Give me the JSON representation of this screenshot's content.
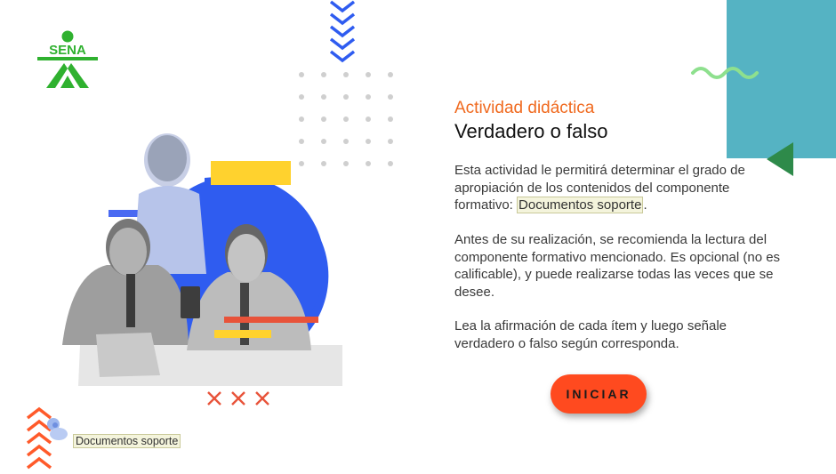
{
  "logo": {
    "text": "SENA",
    "color": "#2fb12f"
  },
  "content": {
    "subtitle": "Actividad didáctica",
    "title": "Verdadero o falso",
    "p1_before": "Esta actividad le permitirá determinar el grado de apropiación de los contenidos del componente formativo: ",
    "p1_link": "Documentos soporte",
    "p1_after": ".",
    "p2": "Antes de su realización, se recomienda la lectura del componente formativo mencionado. Es opcional (no es calificable), y puede realizarse todas las veces que se desee.",
    "p3": "Lea la afirmación de cada ítem y luego señale verdadero o falso según corresponda."
  },
  "start_button": {
    "label": "INICIAR"
  },
  "footer_link": {
    "label": "Documentos soporte"
  },
  "colors": {
    "accent_orange": "#f06a1f",
    "button": "#ff4a1f",
    "teal": "#55b3c3",
    "green": "#2e8a4a",
    "blue": "#2f5cf0",
    "yellow": "#ffd22e",
    "red": "#e8533a"
  },
  "icons": {
    "top_chevrons": "chevrons-down-icon",
    "bottom_chevrons": "chevrons-up-icon",
    "crosses": "x-marks-icon",
    "pin": "pin-icon"
  }
}
